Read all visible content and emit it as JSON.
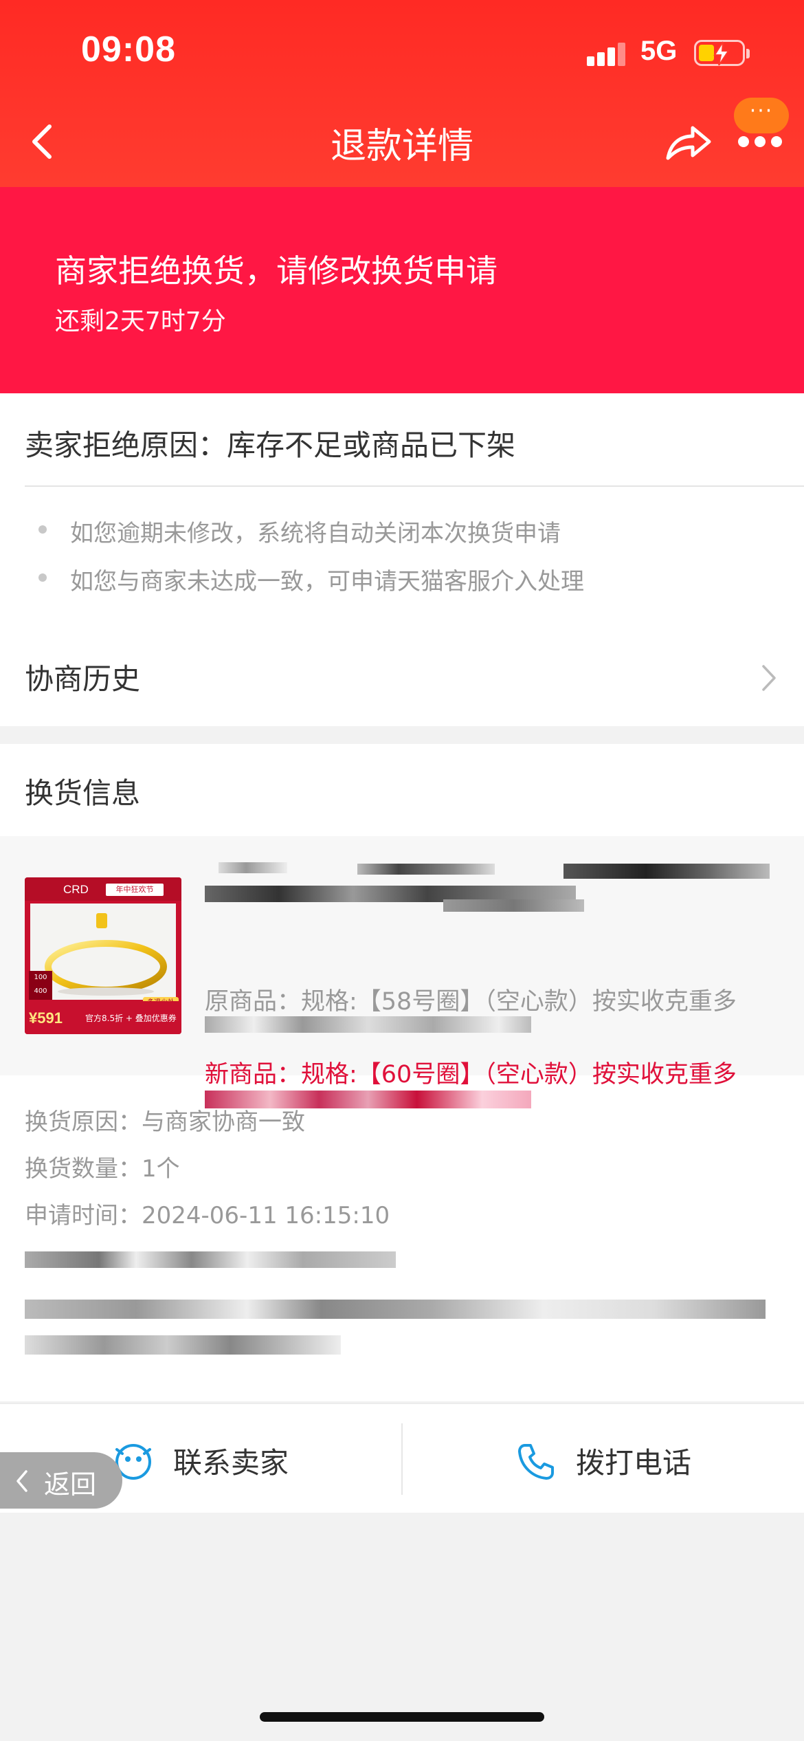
{
  "status_bar": {
    "time": "09:08",
    "network": "5G"
  },
  "nav": {
    "title": "退款详情",
    "badge": "···"
  },
  "banner": {
    "title": "商家拒绝换货，请修改换货申请",
    "countdown": "还剩2天7时7分"
  },
  "reason": {
    "title": "卖家拒绝原因：库存不足或商品已下架",
    "tips": [
      "如您逾期未修改，系统将自动关闭本次换货申请",
      "如您与商家未达成一致，可申请天猫客服介入处理"
    ],
    "history_label": "协商历史"
  },
  "exchange": {
    "section_title": "换货信息",
    "product_thumb": {
      "logo": "CRD",
      "brand_tag": "年中狂欢节",
      "price": "¥591",
      "promo": "官方8.5折 + 叠加优惠券",
      "badge": "多退少补"
    },
    "old_spec": "原商品：规格:【58号圈】（空心款）按实收克重多",
    "new_spec": "新商品：规格:【60号圈】（空心款）按实收克重多",
    "details": [
      {
        "label": "换货原因：",
        "value": "与商家协商一致"
      },
      {
        "label": "换货数量：",
        "value": "1个"
      },
      {
        "label": "申请时间：",
        "value": "2024-06-11 16:15:10"
      }
    ]
  },
  "actions": {
    "contact_seller": "联系卖家",
    "call_phone": "拨打电话"
  },
  "back_pill": {
    "label": "返回"
  },
  "colors": {
    "header_red": "#ff2a24",
    "banner_red": "#ff1744",
    "new_spec_red": "#e0103a",
    "icon_blue": "#1a9ae0"
  }
}
